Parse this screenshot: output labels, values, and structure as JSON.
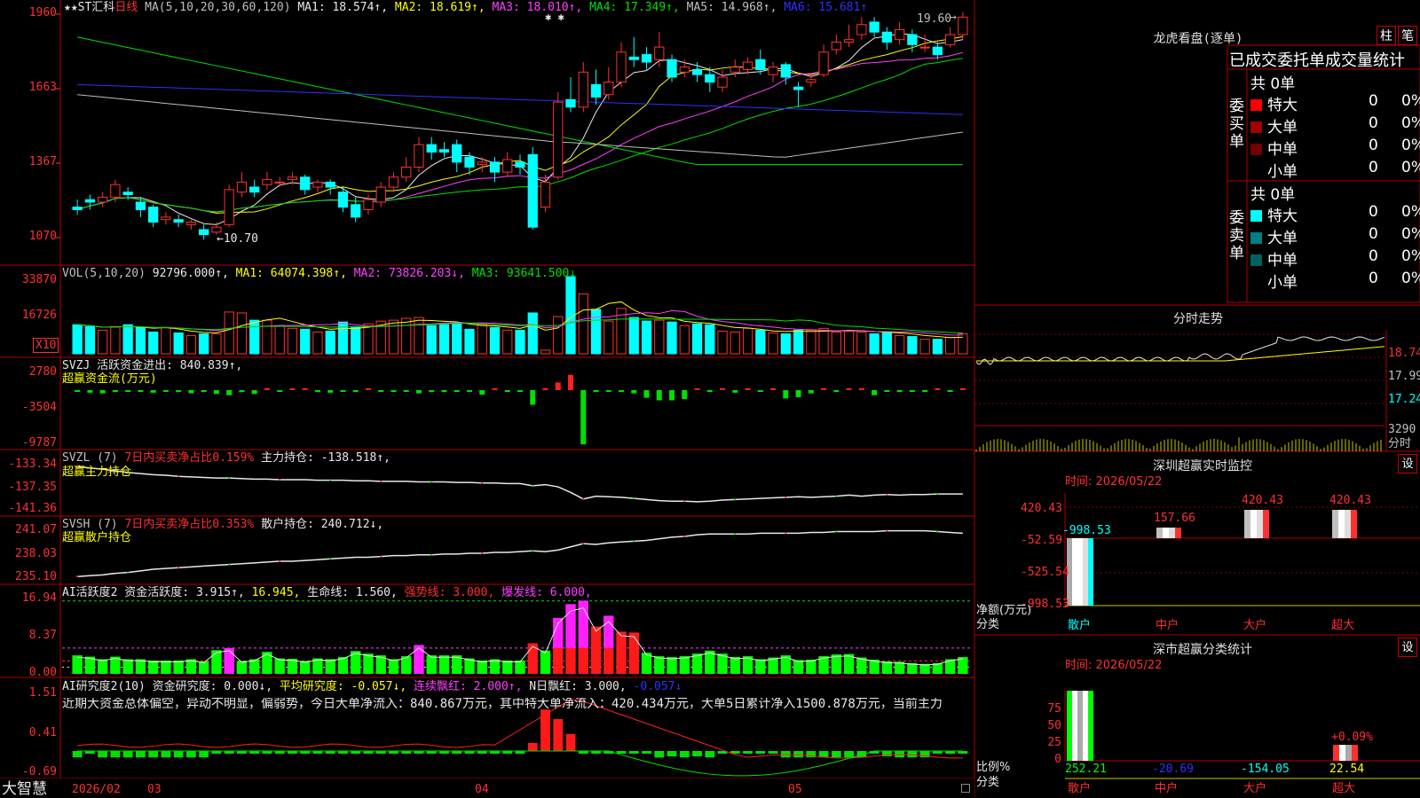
{
  "main_chart": {
    "title_parts": [
      {
        "text": "★★ST汇科",
        "color": "#e8e8e8"
      },
      {
        "text": "日线",
        "color": "#ff3030"
      },
      {
        "text": " MA(5,10,20,30,60,120) ",
        "color": "#c0c0c0"
      },
      {
        "text": "MA1: 18.574↑,",
        "color": "#e8e8e8"
      },
      {
        "text": " MA2: 18.619↑,",
        "color": "#ffff00"
      },
      {
        "text": " MA3: 18.010↑,",
        "color": "#ff40ff"
      },
      {
        "text": " MA4: 17.349↑,",
        "color": "#00e000"
      },
      {
        "text": " MA5: 14.968↑,",
        "color": "#c0c0c0"
      },
      {
        "text": " MA6: 15.681↑",
        "color": "#3030ff"
      }
    ],
    "y_axis": [
      "1960",
      "1663",
      "1367",
      "1070"
    ],
    "high_label": "19.60",
    "low_label": "←10.70",
    "star_marks": "✱ ✱"
  },
  "vol_panel": {
    "title_parts": [
      {
        "text": "VOL(5,10,20) ",
        "color": "#c0c0c0"
      },
      {
        "text": "92796.000↑,",
        "color": "#e8e8e8"
      },
      {
        "text": " MA1: 64074.398↑,",
        "color": "#ffff00"
      },
      {
        "text": " MA2: 73826.203↓,",
        "color": "#ff40ff"
      },
      {
        "text": " MA3: 93641.500↓",
        "color": "#00e000"
      }
    ],
    "y_axis": [
      "33870",
      "16726"
    ],
    "unit": "X10"
  },
  "svzj_panel": {
    "title_parts": [
      {
        "text": "SVZJ  活跃资金进出: 840.839↑,",
        "color": "#e8e8e8"
      }
    ],
    "subtitle": "超赢资金流(万元)",
    "y_axis": [
      "2780",
      "-3504",
      "-9787"
    ]
  },
  "svzl_panel": {
    "title_parts": [
      {
        "text": "SVZL (7) ",
        "color": "#c0c0c0"
      },
      {
        "text": "7日内买卖净占比0.159%",
        "color": "#ff3030"
      },
      {
        "text": " 主力持仓: -138.518↑,",
        "color": "#e8e8e8"
      }
    ],
    "subtitle": "超赢主力持仓",
    "y_axis": [
      "-133.34",
      "-137.35",
      "-141.36"
    ]
  },
  "svsh_panel": {
    "title_parts": [
      {
        "text": "SVSH (7) ",
        "color": "#c0c0c0"
      },
      {
        "text": "7日内买卖净占比0.353%",
        "color": "#ff3030"
      },
      {
        "text": " 散户持仓: 240.712↓,",
        "color": "#e8e8e8"
      }
    ],
    "subtitle": "超赢散户持仓",
    "y_axis": [
      "241.07",
      "238.03",
      "235.10"
    ]
  },
  "ai_active_panel": {
    "title_parts": [
      {
        "text": "AI活跃度2 资金活跃度: 3.915↑,",
        "color": "#e8e8e8"
      },
      {
        "text": " 16.945,",
        "color": "#ffff00"
      },
      {
        "text": " 生命线: 1.560,",
        "color": "#e8e8e8"
      },
      {
        "text": " 强势线: 3.000,",
        "color": "#ff3030"
      },
      {
        "text": " 爆发线: 6.000,",
        "color": "#ff40ff"
      }
    ],
    "y_axis": [
      "16.94",
      "8.37",
      "0.00"
    ]
  },
  "ai_research_panel": {
    "title_parts": [
      {
        "text": "AI研究度2(10) 资金研究度: 0.000↓,",
        "color": "#e8e8e8"
      },
      {
        "text": " 平均研究度: -0.057↓,",
        "color": "#ffff00"
      },
      {
        "text": " 连续飘红: 2.000↑,",
        "color": "#ff40ff"
      },
      {
        "text": " N日飘红: 3.000,",
        "color": "#e8e8e8"
      },
      {
        "text": " -0.057↓",
        "color": "#3030ff"
      }
    ],
    "comment": "近期大资金总体偏空，异动不明显，偏弱势，今日大单净流入：840.867万元，其中特大单净流入：420.434万元，大单5日累计净入1500.878万元，当前主力",
    "y_axis": [
      "1.51",
      "0.41",
      "-0.69"
    ]
  },
  "bottom_bar": {
    "brand": "大智慧",
    "dates": [
      "2026/02",
      "03",
      "04",
      "05"
    ]
  },
  "right_panel": {
    "dragon_title": "龙虎看盘(逐单)",
    "btn_bar": "柱",
    "btn_pen": "笔",
    "table_header": "已成交委托单成交量统计",
    "buy_label": "委买单",
    "sell_label": "委卖单",
    "buy_total": "共 0单",
    "sell_total": "共 0单",
    "buy_rows": [
      {
        "name": "特大",
        "count": "0",
        "pct": "0%",
        "color": "#ff0000"
      },
      {
        "name": "大单",
        "count": "0",
        "pct": "0%",
        "color": "#a00000"
      },
      {
        "name": "中单",
        "count": "0",
        "pct": "0%",
        "color": "#700000"
      },
      {
        "name": "小单",
        "count": "0",
        "pct": "0%",
        "color": "#000000"
      }
    ],
    "sell_rows": [
      {
        "name": "特大",
        "count": "0",
        "pct": "0%",
        "color": "#00ffff"
      },
      {
        "name": "大单",
        "count": "0",
        "pct": "0%",
        "color": "#008080"
      },
      {
        "name": "中单",
        "count": "0",
        "pct": "0%",
        "color": "#006060"
      },
      {
        "name": "小单",
        "count": "0",
        "pct": "0%",
        "color": "#000000"
      }
    ],
    "intraday_title": "分时走势",
    "intraday_axis": [
      "18.74",
      "17.99",
      "17.24"
    ],
    "intraday_vol": "3290",
    "intraday_vol_unit": "分时",
    "sz_monitor_title": "深圳超赢实时监控",
    "sz_set": "设",
    "sz_time": "时间: 2026/05/22",
    "sz_axis": [
      "420.43",
      "-52.59",
      "-525.54",
      "-998.53"
    ],
    "sz_net_label": "净额(万元)",
    "sz_category_label": "分类",
    "sz_bars": [
      {
        "name": "散户",
        "value": "-998.53",
        "nameColor": "#00ffff"
      },
      {
        "name": "中户",
        "value": "157.66",
        "nameColor": "#ff3030"
      },
      {
        "name": "大户",
        "value": "420.43",
        "nameColor": "#ff3030"
      },
      {
        "name": "超大",
        "value": "420.43",
        "nameColor": "#ff3030"
      }
    ],
    "sc_title": "深市超赢分类统计",
    "sc_set": "设",
    "sc_time": "时间: 2026/05/22",
    "sc_axis": [
      "75",
      "50",
      "25",
      "0"
    ],
    "sc_ratio_label": "比例%",
    "sc_category_label": "分类",
    "sc_values": [
      {
        "name": "散户",
        "value": "252.21",
        "color": "#00ff00"
      },
      {
        "name": "中户",
        "value": "-20.69",
        "color": "#3030ff"
      },
      {
        "name": "大户",
        "value": "-154.05",
        "color": "#00ffff"
      },
      {
        "name": "超大",
        "value": "22.54",
        "color": "#ffff00"
      }
    ],
    "sc_top_label": "+0.09%"
  },
  "chart_data": {
    "type": "bar",
    "title": "★★ST汇科 日线",
    "categories": [
      "散户",
      "中户",
      "大户",
      "超大"
    ],
    "series": [
      {
        "name": "净额(万元)",
        "values": [
          -998.53,
          157.66,
          420.43,
          420.43
        ]
      }
    ],
    "y_axis_ticks": [
      420.43,
      -52.59,
      -525.54,
      -998.53
    ],
    "price_axis_ticks": [
      1960,
      1663,
      1367,
      1070
    ],
    "volume_axis_ticks": [
      33870,
      16726
    ],
    "candles": [
      [
        12.0,
        11.9,
        12.3,
        11.7
      ],
      [
        12.3,
        12.2,
        12.5,
        11.9
      ],
      [
        12.2,
        12.4,
        12.6,
        12.0
      ],
      [
        12.4,
        12.9,
        13.1,
        12.2
      ],
      [
        12.6,
        12.5,
        12.8,
        12.3
      ],
      [
        12.2,
        11.9,
        12.4,
        11.6
      ],
      [
        12.0,
        11.4,
        12.1,
        11.2
      ],
      [
        11.5,
        11.6,
        11.8,
        11.3
      ],
      [
        11.5,
        11.4,
        11.7,
        11.2
      ],
      [
        11.3,
        11.4,
        11.5,
        11.1
      ],
      [
        11.1,
        10.9,
        11.3,
        10.7
      ],
      [
        11.0,
        11.2,
        11.4,
        10.9
      ],
      [
        11.3,
        12.7,
        12.9,
        11.2
      ],
      [
        12.6,
        13.0,
        13.4,
        12.4
      ],
      [
        12.8,
        12.6,
        13.1,
        12.4
      ],
      [
        12.9,
        13.1,
        13.4,
        12.7
      ],
      [
        13.0,
        13.0,
        13.2,
        12.8
      ],
      [
        13.1,
        13.2,
        13.4,
        12.9
      ],
      [
        13.2,
        12.7,
        13.3,
        12.5
      ],
      [
        12.8,
        13.0,
        13.1,
        12.6
      ],
      [
        13.0,
        12.8,
        13.1,
        12.5
      ],
      [
        12.6,
        12.0,
        12.8,
        11.8
      ],
      [
        12.1,
        11.6,
        12.4,
        11.4
      ],
      [
        11.9,
        12.3,
        12.5,
        11.7
      ],
      [
        12.2,
        12.8,
        13.0,
        12.0
      ],
      [
        12.8,
        13.2,
        13.4,
        12.6
      ],
      [
        13.2,
        13.6,
        14.0,
        13.0
      ],
      [
        13.6,
        14.5,
        14.8,
        13.4
      ],
      [
        14.5,
        14.2,
        14.8,
        13.9
      ],
      [
        14.3,
        14.2,
        14.6,
        14.0
      ],
      [
        14.5,
        13.8,
        14.7,
        13.4
      ],
      [
        14.0,
        13.6,
        14.2,
        13.3
      ],
      [
        13.7,
        13.8,
        14.0,
        13.4
      ],
      [
        13.8,
        13.4,
        14.0,
        13.0
      ],
      [
        13.4,
        13.9,
        14.2,
        13.2
      ],
      [
        13.8,
        13.6,
        14.1,
        13.3
      ],
      [
        14.1,
        11.2,
        14.4,
        11.1
      ],
      [
        12.0,
        13.0,
        13.3,
        11.8
      ],
      [
        13.2,
        16.2,
        16.6,
        13.1
      ],
      [
        16.3,
        16.0,
        17.2,
        15.8
      ],
      [
        16.0,
        17.4,
        17.8,
        15.8
      ],
      [
        16.9,
        16.4,
        17.5,
        16.1
      ],
      [
        16.5,
        17.0,
        17.6,
        16.3
      ],
      [
        17.0,
        18.2,
        18.6,
        16.8
      ],
      [
        18.0,
        17.9,
        18.8,
        17.6
      ],
      [
        18.1,
        17.8,
        18.4,
        17.5
      ],
      [
        17.9,
        18.4,
        19.0,
        17.6
      ],
      [
        17.9,
        17.2,
        18.1,
        17.0
      ],
      [
        17.4,
        17.6,
        17.9,
        17.2
      ],
      [
        17.5,
        17.3,
        17.8,
        17.0
      ],
      [
        17.3,
        17.0,
        17.6,
        16.6
      ],
      [
        16.8,
        17.2,
        17.5,
        16.6
      ],
      [
        17.4,
        17.6,
        17.9,
        17.2
      ],
      [
        17.5,
        17.8,
        18.0,
        17.3
      ],
      [
        17.9,
        17.5,
        18.3,
        17.3
      ],
      [
        17.3,
        17.6,
        17.8,
        17.0
      ],
      [
        17.7,
        17.2,
        17.8,
        16.9
      ],
      [
        16.8,
        16.7,
        17.0,
        16.0
      ],
      [
        17.0,
        17.1,
        17.3,
        16.8
      ],
      [
        17.3,
        18.2,
        18.5,
        17.2
      ],
      [
        18.3,
        18.6,
        18.9,
        18.1
      ],
      [
        18.6,
        18.7,
        19.3,
        18.4
      ],
      [
        18.9,
        19.3,
        19.6,
        18.7
      ],
      [
        19.4,
        19.0,
        19.6,
        18.8
      ],
      [
        19.0,
        18.6,
        19.2,
        18.3
      ],
      [
        18.7,
        19.1,
        19.4,
        18.5
      ],
      [
        18.9,
        18.5,
        19.1,
        18.2
      ],
      [
        18.4,
        18.4,
        18.9,
        18.2
      ],
      [
        18.4,
        18.1,
        18.6,
        17.9
      ],
      [
        18.5,
        18.9,
        19.2,
        18.4
      ],
      [
        18.9,
        19.6,
        19.8,
        18.7
      ]
    ],
    "volumes": [
      3.2,
      3.0,
      2.6,
      3.0,
      3.2,
      2.9,
      2.4,
      2.9,
      2.3,
      2.0,
      2.2,
      2.2,
      4.6,
      4.5,
      3.7,
      3.7,
      3.1,
      2.8,
      2.7,
      2.4,
      2.5,
      3.5,
      2.9,
      3.3,
      3.6,
      3.7,
      3.9,
      4.0,
      3.1,
      3.2,
      3.4,
      2.7,
      3.2,
      2.9,
      2.6,
      2.6,
      4.5,
      0.4,
      4.1,
      8.5,
      6.6,
      4.9,
      3.6,
      5.0,
      4.0,
      3.6,
      3.7,
      3.5,
      3.1,
      3.3,
      3.2,
      2.5,
      2.4,
      2.8,
      2.6,
      2.3,
      2.2,
      2.6,
      2.6,
      2.8,
      2.4,
      2.5,
      2.4,
      2.2,
      2.4,
      2.0,
      1.9,
      1.6,
      1.6,
      1.8,
      2.2
    ],
    "flows": [
      -0.2,
      -0.4,
      -0.5,
      -0.3,
      -0.2,
      -0.1,
      -0.4,
      -0.2,
      -0.3,
      -0.5,
      -0.2,
      -0.6,
      -0.8,
      -0.3,
      -0.6,
      0.3,
      -0.2,
      0.2,
      0.3,
      -0.3,
      -0.4,
      -0.2,
      -0.3,
      0.3,
      -0.2,
      -0.3,
      -0.2,
      -0.5,
      -0.2,
      -0.3,
      -0.3,
      -0.2,
      -0.7,
      0.2,
      -0.3,
      -0.3,
      -2.3,
      0.3,
      1.2,
      2.4,
      -8.5,
      -0.3,
      -0.2,
      -0.3,
      -0.5,
      -1.2,
      -1.6,
      -1.6,
      -1.4,
      0.2,
      -0.3,
      0.2,
      -0.4,
      0.3,
      -0.2,
      0.3,
      -1.3,
      -1.1,
      -0.5,
      0.3,
      -0.3,
      0.2,
      0.3,
      -0.8,
      -0.2,
      -0.3,
      -0.2,
      -0.3,
      0.3,
      -0.2,
      0.3
    ],
    "ai_active": [
      4.3,
      4.0,
      3.4,
      4.0,
      3.4,
      3.4,
      3.1,
      3.1,
      3.1,
      3.4,
      2.9,
      5.5,
      6.0,
      3.0,
      3.4,
      5.1,
      3.6,
      3.5,
      3.0,
      3.6,
      3.4,
      3.9,
      5.3,
      4.7,
      4.3,
      3.4,
      4.1,
      6.7,
      4.3,
      4.3,
      4.3,
      3.6,
      3.1,
      3.4,
      3.1,
      3.1,
      7.1,
      5.4,
      13.0,
      16.2,
      17.0,
      11.0,
      13.5,
      9.8,
      9.6,
      4.9,
      4.1,
      3.9,
      4.1,
      4.7,
      5.4,
      4.7,
      3.9,
      4.1,
      3.4,
      3.8,
      4.3,
      3.2,
      3.3,
      4.1,
      4.5,
      4.6,
      3.8,
      3.3,
      2.9,
      2.8,
      2.5,
      2.3,
      2.5,
      3.4,
      3.9
    ],
    "ai_research": [
      -0.12,
      -0.05,
      -0.12,
      -0.12,
      -0.12,
      -0.12,
      -0.12,
      -0.12,
      -0.12,
      -0.12,
      -0.12,
      -0.05,
      -0.05,
      -0.05,
      -0.05,
      -0.05,
      -0.05,
      -0.05,
      -0.05,
      -0.05,
      -0.05,
      -0.05,
      -0.05,
      -0.05,
      -0.05,
      -0.05,
      -0.05,
      -0.05,
      -0.05,
      -0.05,
      -0.05,
      -0.05,
      -0.05,
      -0.05,
      -0.05,
      -0.05,
      0.15,
      0.78,
      0.6,
      0.32,
      -0.05,
      -0.05,
      -0.05,
      -0.05,
      -0.05,
      -0.05,
      -0.12,
      -0.1,
      -0.12,
      -0.1,
      -0.12,
      -0.05,
      -0.05,
      -0.05,
      -0.05,
      -0.05,
      -0.12,
      -0.12,
      -0.12,
      -0.12,
      -0.12,
      -0.12,
      -0.12,
      -0.05,
      -0.1,
      -0.12,
      -0.12,
      -0.12,
      -0.05,
      -0.05,
      -0.05
    ],
    "svzl": [
      -133.5,
      -133.8,
      -134.0,
      -134.3,
      -134.6,
      -134.8,
      -135.0,
      -135.1,
      -135.3,
      -135.4,
      -135.5,
      -135.6,
      -135.6,
      -135.7,
      -135.8,
      -135.8,
      -135.9,
      -135.9,
      -135.9,
      -136.0,
      -136.0,
      -136.0,
      -136.1,
      -136.1,
      -136.2,
      -136.2,
      -136.2,
      -136.3,
      -136.3,
      -136.3,
      -136.4,
      -136.4,
      -136.5,
      -136.5,
      -136.6,
      -136.6,
      -137.0,
      -136.8,
      -137.2,
      -138.2,
      -139.4,
      -138.9,
      -139.0,
      -139.1,
      -139.3,
      -139.5,
      -139.7,
      -139.8,
      -139.8,
      -139.9,
      -139.8,
      -139.6,
      -139.5,
      -139.4,
      -139.3,
      -139.2,
      -139.1,
      -139.0,
      -139.1,
      -139.0,
      -138.9,
      -138.7,
      -138.9,
      -138.7,
      -138.6,
      -138.7,
      -138.6,
      -138.6,
      -138.5,
      -138.5,
      -138.5
    ],
    "svsh": [
      235.3,
      235.4,
      235.5,
      235.7,
      235.8,
      236.0,
      236.2,
      236.3,
      236.4,
      236.5,
      236.6,
      236.7,
      236.8,
      236.9,
      237.0,
      237.1,
      237.2,
      237.2,
      237.3,
      237.4,
      237.5,
      237.6,
      237.7,
      237.7,
      237.8,
      237.9,
      237.9,
      238.0,
      238.0,
      238.1,
      238.1,
      238.2,
      238.2,
      238.3,
      238.3,
      238.4,
      238.5,
      238.4,
      238.6,
      239.0,
      239.4,
      239.3,
      239.5,
      239.6,
      239.7,
      239.8,
      240.0,
      240.2,
      240.3,
      240.5,
      240.6,
      240.6,
      240.6,
      240.6,
      240.7,
      240.7,
      240.7,
      240.7,
      240.8,
      240.8,
      240.9,
      240.9,
      240.9,
      240.9,
      241.0,
      241.0,
      241.0,
      241.0,
      240.9,
      240.8,
      240.7
    ]
  }
}
